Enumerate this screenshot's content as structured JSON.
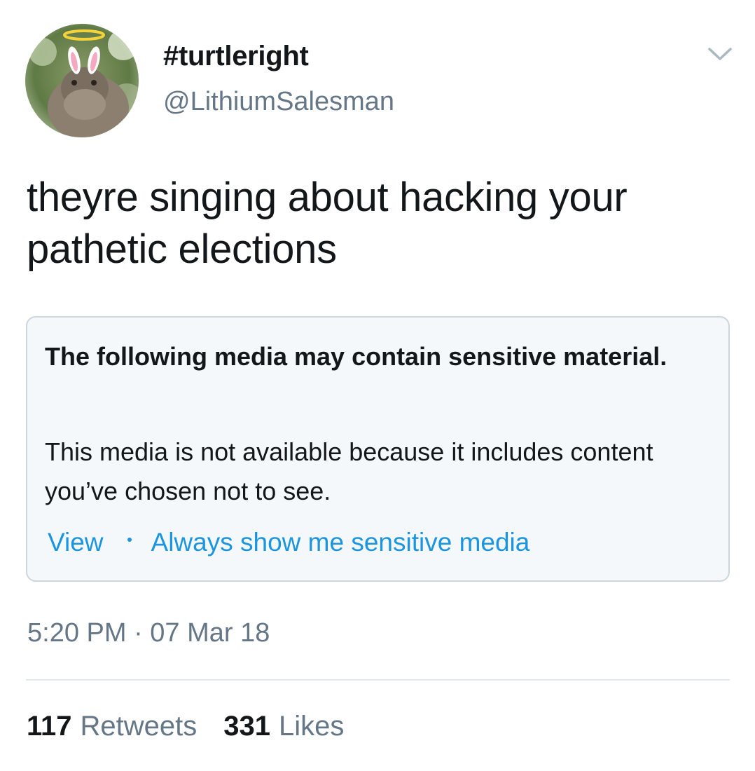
{
  "user": {
    "display_name": "#turtleright",
    "handle": "@LithiumSalesman",
    "avatar_icon": "turtle-with-halo-and-bunny-ears"
  },
  "tweet": {
    "text": "theyre singing about hacking your pathetic elections",
    "timestamp": "5:20 PM · 07 Mar 18"
  },
  "sensitive_card": {
    "title": "The following media may contain sensitive material.",
    "body": "This media is not available because it includes content you’ve chosen not to see.",
    "view_label": "View",
    "always_show_label": "Always show me sensitive media"
  },
  "stats": {
    "retweets_count": "117",
    "retweets_label": "Retweets",
    "likes_count": "331",
    "likes_label": "Likes"
  },
  "colors": {
    "link": "#1b95e0",
    "secondary_text": "#657786",
    "primary_text": "#14171a",
    "card_background": "#f5f8fa",
    "card_border": "#ccd6dd"
  }
}
